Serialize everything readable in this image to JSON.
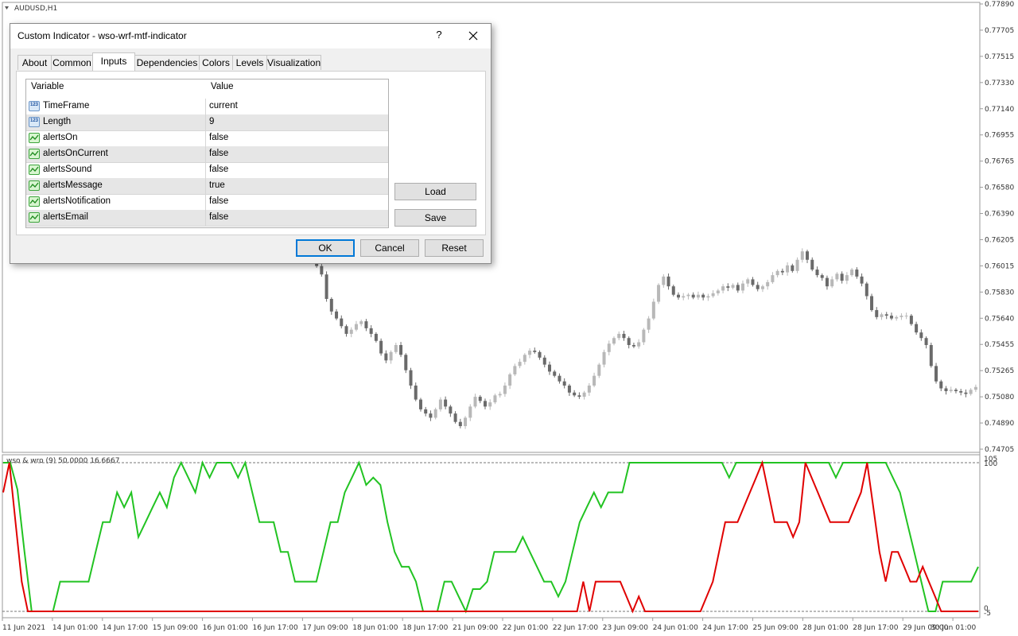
{
  "chart": {
    "symbol_label": "AUDUSD,H1",
    "price_labels": [
      "0.77890",
      "0.77705",
      "0.77515",
      "0.77330",
      "0.77140",
      "0.76955",
      "0.76765",
      "0.76580",
      "0.76390",
      "0.76205",
      "0.76015",
      "0.75830",
      "0.75640",
      "0.75455",
      "0.75265",
      "0.75080",
      "0.74890",
      "0.74705"
    ],
    "time_labels": [
      "11 Jun 2021",
      "14 Jun 01:00",
      "14 Jun 17:00",
      "15 Jun 09:00",
      "16 Jun 01:00",
      "16 Jun 17:00",
      "17 Jun 09:00",
      "18 Jun 01:00",
      "18 Jun 17:00",
      "21 Jun 09:00",
      "22 Jun 01:00",
      "22 Jun 17:00",
      "23 Jun 09:00",
      "24 Jun 01:00",
      "24 Jun 17:00",
      "25 Jun 09:00",
      "28 Jun 01:00",
      "28 Jun 17:00",
      "29 Jun 09:00",
      "30 Jun 01:00"
    ],
    "indicator_label": "wso & wro (9) 50.0000 16.6667",
    "indicator_levels": {
      "top_max": "105",
      "top": "100",
      "bottom": "0",
      "bottom_min": "-5"
    },
    "closes": [
      0.76015,
      0.75955,
      0.7578,
      0.7569,
      0.7564,
      0.75585,
      0.7553,
      0.7556,
      0.756,
      0.7562,
      0.7557,
      0.7553,
      0.7548,
      0.7539,
      0.7534,
      0.754,
      0.7545,
      0.7538,
      0.7527,
      0.7516,
      0.7506,
      0.7499,
      0.7496,
      0.7493,
      0.7499,
      0.7506,
      0.7501,
      0.7496,
      0.749,
      0.7487,
      0.7493,
      0.7501,
      0.7508,
      0.7505,
      0.7501,
      0.7504,
      0.7509,
      0.751,
      0.7516,
      0.7524,
      0.753,
      0.7533,
      0.7538,
      0.7541,
      0.754,
      0.7536,
      0.7531,
      0.7526,
      0.7523,
      0.7519,
      0.7516,
      0.7511,
      0.7509,
      0.7508,
      0.7511,
      0.7516,
      0.7523,
      0.7531,
      0.754,
      0.7546,
      0.755,
      0.7553,
      0.755,
      0.7545,
      0.7544,
      0.7547,
      0.7556,
      0.7564,
      0.7576,
      0.7588,
      0.7594,
      0.7587,
      0.7581,
      0.7579,
      0.758,
      0.7581,
      0.7579,
      0.7581,
      0.7579,
      0.758,
      0.7582,
      0.7584,
      0.7587,
      0.7586,
      0.7588,
      0.7584,
      0.7589,
      0.7592,
      0.7588,
      0.7585,
      0.7587,
      0.759,
      0.7595,
      0.7598,
      0.7597,
      0.7602,
      0.7598,
      0.7606,
      0.7612,
      0.7606,
      0.7599,
      0.7595,
      0.7593,
      0.7587,
      0.7592,
      0.7596,
      0.7591,
      0.7595,
      0.7599,
      0.7594,
      0.7589,
      0.758,
      0.757,
      0.7565,
      0.7567,
      0.7566,
      0.7564,
      0.7565,
      0.7566,
      0.7566,
      0.756,
      0.7554,
      0.755,
      0.7545,
      0.753,
      0.7519,
      0.7514,
      0.7512,
      0.7513,
      0.7512,
      0.7511,
      0.751,
      0.7513,
      0.7515
    ],
    "green_line": [
      100,
      100,
      82,
      40,
      0,
      0,
      0,
      0,
      20,
      20,
      20,
      20,
      20,
      40,
      60,
      60,
      80,
      70,
      80,
      50,
      60,
      70,
      80,
      70,
      90,
      100,
      90,
      80,
      100,
      90,
      100,
      100,
      100,
      90,
      100,
      80,
      60,
      60,
      60,
      40,
      40,
      20,
      20,
      20,
      20,
      40,
      60,
      60,
      80,
      90,
      100,
      85,
      90,
      85,
      60,
      40,
      30,
      30,
      20,
      0,
      0,
      0,
      20,
      20,
      10,
      0,
      15,
      15,
      20,
      40,
      40,
      40,
      40,
      50,
      40,
      30,
      20,
      20,
      10,
      20,
      40,
      60,
      70,
      80,
      70,
      80,
      80,
      80,
      100,
      100,
      100,
      100,
      100,
      100,
      100,
      100,
      100,
      100,
      100,
      100,
      100,
      100,
      90,
      100,
      100,
      100,
      100,
      100,
      100,
      100,
      100,
      100,
      100,
      100,
      100,
      100,
      100,
      90,
      100,
      100,
      100,
      100,
      100,
      100,
      100,
      90,
      80,
      60,
      40,
      20,
      0,
      0,
      20,
      20,
      20,
      20,
      20,
      30
    ],
    "red_line": [
      80,
      100,
      60,
      20,
      0,
      0,
      0,
      0,
      0,
      0,
      0,
      0,
      0,
      0,
      0,
      0,
      0,
      0,
      0,
      0,
      0,
      0,
      0,
      0,
      0,
      0,
      0,
      0,
      0,
      0,
      0,
      0,
      0,
      0,
      0,
      0,
      0,
      0,
      0,
      0,
      0,
      0,
      0,
      0,
      0,
      0,
      0,
      0,
      0,
      0,
      0,
      0,
      0,
      0,
      0,
      0,
      0,
      0,
      0,
      0,
      0,
      0,
      0,
      0,
      0,
      0,
      0,
      0,
      0,
      0,
      0,
      0,
      0,
      0,
      0,
      0,
      0,
      0,
      0,
      0,
      0,
      0,
      0,
      0,
      0,
      0,
      0,
      0,
      0,
      0,
      0,
      0,
      0,
      0,
      20,
      0,
      20,
      20,
      20,
      20,
      20,
      10,
      0,
      10,
      0,
      0,
      0,
      0,
      0,
      0,
      0,
      0,
      0,
      0,
      10,
      20,
      40,
      60,
      60,
      60,
      70,
      80,
      90,
      100,
      80,
      60,
      60,
      60,
      50,
      60,
      100,
      90,
      80,
      70,
      60,
      60,
      60,
      60,
      70,
      80,
      100,
      70,
      40,
      20,
      40,
      40,
      30,
      20,
      20,
      30,
      20,
      10,
      0,
      0,
      0,
      0,
      0,
      0,
      0
    ]
  },
  "dialog": {
    "title": "Custom Indicator - wso-wrf-mtf-indicator",
    "help": "?",
    "tabs": [
      "About",
      "Common",
      "Inputs",
      "Dependencies",
      "Colors",
      "Levels",
      "Visualization"
    ],
    "active_tab": "Inputs",
    "grid_headers": {
      "variable": "Variable",
      "value": "Value"
    },
    "rows": [
      {
        "variable": "TimeFrame",
        "value": "current",
        "icon": "numeric-param-icon"
      },
      {
        "variable": "Length",
        "value": "9",
        "icon": "numeric-param-icon"
      },
      {
        "variable": "alertsOn",
        "value": "false",
        "icon": "bool-param-icon"
      },
      {
        "variable": "alertsOnCurrent",
        "value": "false",
        "icon": "bool-param-icon"
      },
      {
        "variable": "alertsSound",
        "value": "false",
        "icon": "bool-param-icon"
      },
      {
        "variable": "alertsMessage",
        "value": "true",
        "icon": "bool-param-icon"
      },
      {
        "variable": "alertsNotification",
        "value": "false",
        "icon": "bool-param-icon"
      },
      {
        "variable": "alertsEmail",
        "value": "false",
        "icon": "bool-param-icon"
      }
    ],
    "num_icon_text": "123",
    "buttons": {
      "load": "Load",
      "save": "Save",
      "ok": "OK",
      "cancel": "Cancel",
      "reset": "Reset"
    }
  }
}
